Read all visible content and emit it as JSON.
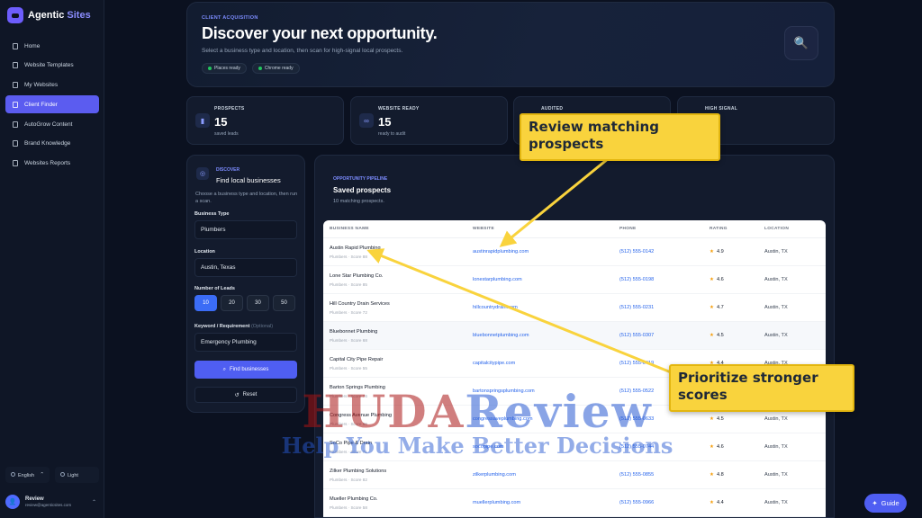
{
  "app": {
    "name_main": "Agentic",
    "name_accent": " Sites"
  },
  "sidebar": {
    "items": [
      {
        "label": "Home"
      },
      {
        "label": "Website Templates"
      },
      {
        "label": "My Websites"
      },
      {
        "label": "Client Finder",
        "active": true
      },
      {
        "label": "AutoGrow Content"
      },
      {
        "label": "Brand Knowledge"
      },
      {
        "label": "Websites Reports"
      }
    ],
    "language": "English",
    "theme": "Light",
    "user": {
      "name": "Review",
      "email": "review@agenticsites.com",
      "initial": "👤"
    }
  },
  "hero": {
    "eyebrow": "CLIENT ACQUISITION",
    "title": "Discover your next opportunity.",
    "subtitle": "Select a business type and location, then scan for high-signal local prospects.",
    "badges": [
      "Places ready",
      "Chrome ready"
    ]
  },
  "stats": [
    {
      "label": "PROSPECTS",
      "value": "15",
      "sub": "saved leads",
      "icon": "bookmark-icon"
    },
    {
      "label": "WEBSITE READY",
      "value": "15",
      "sub": "ready to audit",
      "icon": "link-icon"
    },
    {
      "label": "AUDITED",
      "value": "",
      "sub": "",
      "icon": "check-icon"
    },
    {
      "label": "HIGH SIGNAL",
      "value": "",
      "sub": "",
      "icon": "signal-icon"
    }
  ],
  "discover": {
    "eyebrow": "DISCOVER",
    "title": "Find local businesses",
    "description": "Choose a business type and location, then run a scan.",
    "business_type_label": "Business Type",
    "business_type_value": "Plumbers",
    "location_label": "Location",
    "location_value": "Austin, Texas",
    "leads_label": "Number of Leads",
    "lead_options": [
      "10",
      "20",
      "30",
      "50"
    ],
    "keyword_label": "Keyword / Requirement",
    "keyword_optional": "(Optional)",
    "keyword_value": "Emergency Plumbing",
    "find_label": "Find businesses",
    "reset_label": "Reset"
  },
  "pipeline": {
    "eyebrow": "OPPORTUNITY PIPELINE",
    "title": "Saved prospects",
    "subtitle": "10 matching prospects.",
    "columns": [
      "BUSINESS NAME",
      "WEBSITE",
      "PHONE",
      "RATING",
      "LOCATION"
    ],
    "rows": [
      {
        "name": "Austin Rapid Plumbing",
        "meta": "Plumbers · Score 88",
        "website": "austinrapidplumbing.com",
        "phone": "(512) 555-0142",
        "rating": "4.9",
        "location": "Austin, TX"
      },
      {
        "name": "Lone Star Plumbing Co.",
        "meta": "Plumbers · Score 85",
        "website": "lonestarplumbing.com",
        "phone": "(512) 555-0198",
        "rating": "4.6",
        "location": "Austin, TX"
      },
      {
        "name": "Hill Country Drain Services",
        "meta": "Plumbers · Score 72",
        "website": "hillcountrydrain.com",
        "phone": "(512) 555-0231",
        "rating": "4.7",
        "location": "Austin, TX"
      },
      {
        "name": "Bluebonnet Plumbing",
        "meta": "Plumbers · Score 68",
        "website": "bluebonnetplumbing.com",
        "phone": "(512) 555-0307",
        "rating": "4.5",
        "location": "Austin, TX"
      },
      {
        "name": "Capital City Pipe Repair",
        "meta": "Plumbers · Score 55",
        "website": "capitalcitypipe.com",
        "phone": "(512) 555-0419",
        "rating": "4.4",
        "location": "Austin, TX"
      },
      {
        "name": "Barton Springs Plumbing",
        "meta": "Plumbers · Score 76",
        "website": "bartonspringsplumbing.com",
        "phone": "(512) 555-0522",
        "rating": "4.8",
        "location": "Austin, TX"
      },
      {
        "name": "Congress Avenue Plumbing",
        "meta": "Plumbers · Score 65",
        "website": "congressaveplumbing.com",
        "phone": "(512) 555-0633",
        "rating": "4.5",
        "location": "Austin, TX"
      },
      {
        "name": "SoCo Pipe & Drain",
        "meta": "Plumbers · Score 71",
        "website": "socopipe.com",
        "phone": "(512) 555-0744",
        "rating": "4.6",
        "location": "Austin, TX"
      },
      {
        "name": "Zilker Plumbing Solutions",
        "meta": "Plumbers · Score 82",
        "website": "zilkerplumbing.com",
        "phone": "(512) 555-0855",
        "rating": "4.8",
        "location": "Austin, TX"
      },
      {
        "name": "Mueller Plumbing Co.",
        "meta": "Plumbers · Score 58",
        "website": "muellerplumbing.com",
        "phone": "(512) 555-0966",
        "rating": "4.4",
        "location": "Austin, TX"
      }
    ]
  },
  "annotations": {
    "callout_1": "Review matching prospects",
    "callout_2": "Prioritize stronger scores",
    "color": "#f9d33d"
  },
  "watermark": {
    "line1_red": "HUDA",
    "line1_blue": "Review",
    "line2": "Help You Make Better Decisions"
  },
  "guide_label": "Guide",
  "colors": {
    "accent": "#5b5cf0",
    "background": "#0b1120",
    "link": "#2563eb",
    "star": "#f59e0b"
  }
}
